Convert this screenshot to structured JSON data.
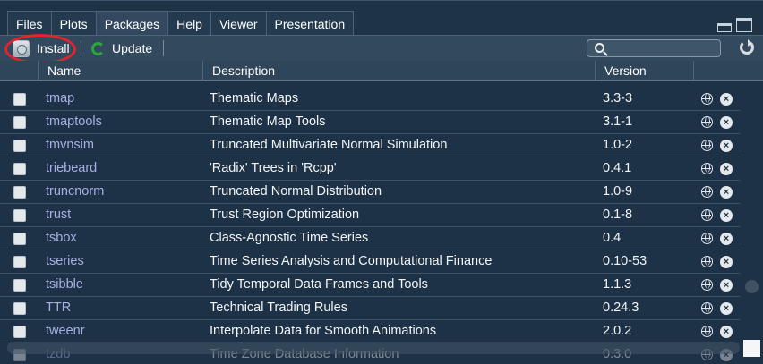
{
  "tabs": [
    {
      "label": "Files",
      "active": false
    },
    {
      "label": "Plots",
      "active": false
    },
    {
      "label": "Packages",
      "active": true
    },
    {
      "label": "Help",
      "active": false
    },
    {
      "label": "Viewer",
      "active": false
    },
    {
      "label": "Presentation",
      "active": false
    }
  ],
  "toolbar": {
    "install_label": "Install",
    "update_label": "Update",
    "search_placeholder": "",
    "highlight_color": "#e2242d",
    "update_icon_color": "#2aa63b"
  },
  "columns": {
    "name": "Name",
    "description": "Description",
    "version": "Version"
  },
  "packages": [
    {
      "name": "tmap",
      "description": "Thematic Maps",
      "version": "3.3-3"
    },
    {
      "name": "tmaptools",
      "description": "Thematic Map Tools",
      "version": "3.1-1"
    },
    {
      "name": "tmvnsim",
      "description": "Truncated Multivariate Normal Simulation",
      "version": "1.0-2"
    },
    {
      "name": "triebeard",
      "description": "'Radix' Trees in 'Rcpp'",
      "version": "0.4.1"
    },
    {
      "name": "truncnorm",
      "description": "Truncated Normal Distribution",
      "version": "1.0-9"
    },
    {
      "name": "trust",
      "description": "Trust Region Optimization",
      "version": "0.1-8"
    },
    {
      "name": "tsbox",
      "description": "Class-Agnostic Time Series",
      "version": "0.4"
    },
    {
      "name": "tseries",
      "description": "Time Series Analysis and Computational Finance",
      "version": "0.10-53"
    },
    {
      "name": "tsibble",
      "description": "Tidy Temporal Data Frames and Tools",
      "version": "1.1.3"
    },
    {
      "name": "TTR",
      "description": "Technical Trading Rules",
      "version": "0.24.3"
    },
    {
      "name": "tweenr",
      "description": "Interpolate Data for Smooth Animations",
      "version": "2.0.2"
    },
    {
      "name": "tzdb",
      "description": "Time Zone Database Information",
      "version": "0.3.0"
    }
  ],
  "colors": {
    "background": "#1e3247",
    "package_link": "#a4b1e2"
  }
}
